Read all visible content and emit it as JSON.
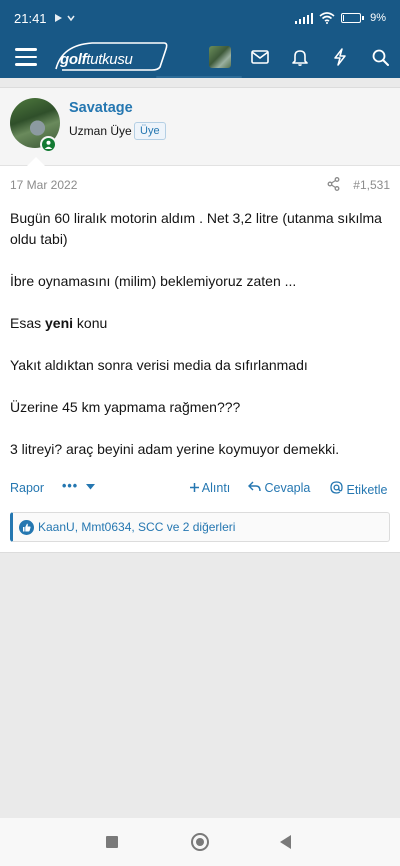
{
  "status_bar": {
    "time": "21:41",
    "battery_percent": "9%",
    "battery_level": 0.09
  },
  "header": {
    "logo": {
      "part1": "golf",
      "part2": "tutkusu"
    },
    "icons": [
      "menu-icon",
      "avatar",
      "mail-icon",
      "bell-icon",
      "bolt-icon",
      "search-icon"
    ]
  },
  "post": {
    "author": {
      "name": "Savatage",
      "title": "Uzman Üye",
      "badge": "Üye",
      "online": true
    },
    "date": "17 Mar 2022",
    "number": "#1,531",
    "body": {
      "p1": "Bugün 60 liralık motorin aldım . Net 3,2 litre (utanma sıkılma oldu tabi)",
      "p2": "İbre oynamasını (milim) beklemiyoruz zaten ...",
      "p3_before": "Esas ",
      "p3_bold": "yeni",
      "p3_after": " konu",
      "p4": "Yakıt aldıktan sonra verisi media da sıfırlanmadı",
      "p5": "Üzerine 45 km yapmama rağmen???",
      "p6": "3 litreyi? araç beyini adam yerine koymuyor demekki."
    },
    "actions": {
      "report": "Rapor",
      "more": "•••",
      "quote": "Alıntı",
      "reply": "Cevapla",
      "mention": "Etiketle"
    },
    "reactions": "KaanU, Mmt0634, SCC ve 2 diğerleri"
  },
  "colors": {
    "brand_header": "#185886",
    "link": "#2577b1",
    "online": "#127a32"
  }
}
